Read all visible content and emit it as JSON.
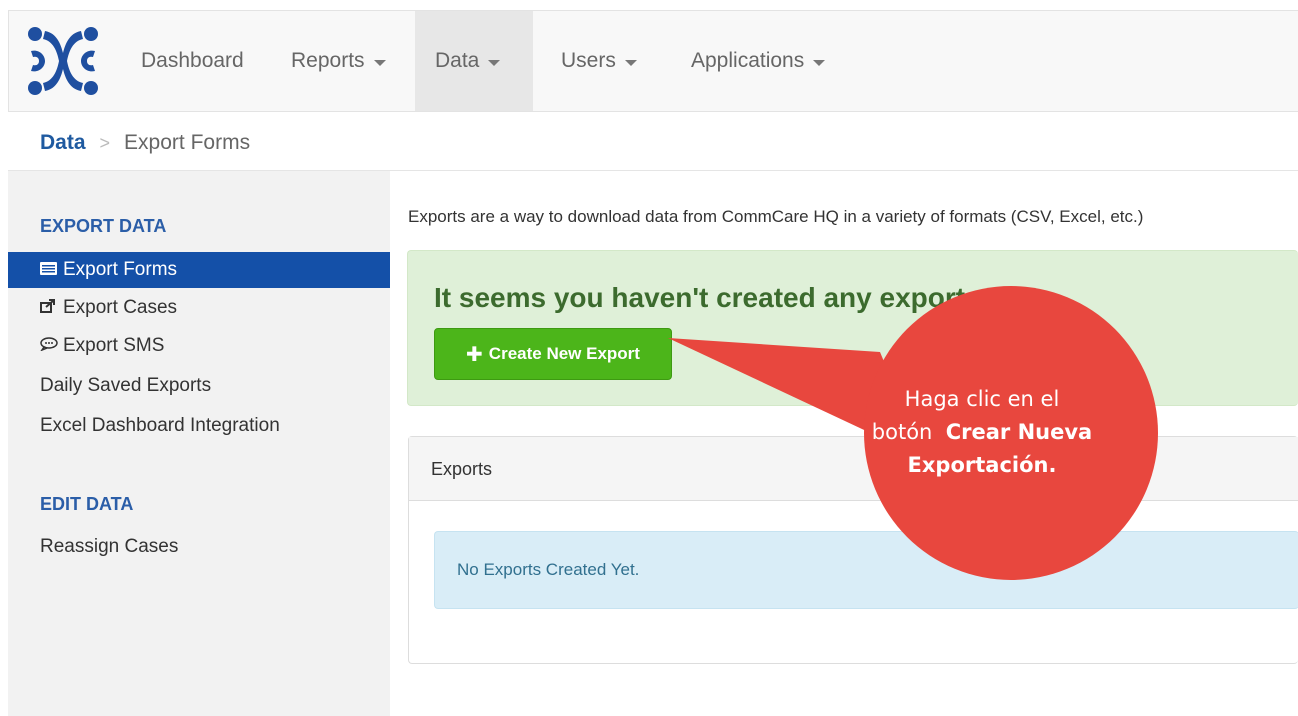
{
  "nav": {
    "items": [
      {
        "label": "Dashboard",
        "dropdown": false
      },
      {
        "label": "Reports",
        "dropdown": true
      },
      {
        "label": "Data",
        "dropdown": true,
        "active": true
      },
      {
        "label": "Users",
        "dropdown": true
      },
      {
        "label": "Applications",
        "dropdown": true
      }
    ]
  },
  "breadcrumb": {
    "parent": "Data",
    "separator": ">",
    "current": "Export Forms"
  },
  "sidebar": {
    "export_heading": "EXPORT DATA",
    "export_items": [
      {
        "label": "Export Forms",
        "icon": "list-icon",
        "active": true
      },
      {
        "label": "Export Cases",
        "icon": "share-icon"
      },
      {
        "label": "Export SMS",
        "icon": "chat-icon"
      },
      {
        "label": "Daily Saved Exports"
      },
      {
        "label": "Excel Dashboard Integration"
      }
    ],
    "edit_heading": "EDIT DATA",
    "edit_items": [
      {
        "label": "Reassign Cases"
      }
    ]
  },
  "main": {
    "intro": "Exports are a way to download data from CommCare HQ in a variety of formats (CSV, Excel, etc.)",
    "alert_title": "It seems you haven't created any exports yet!",
    "create_button": "Create New Export",
    "panel_title": "Exports",
    "empty_message": "No Exports Created Yet."
  },
  "callout": {
    "line1": "Haga clic en el",
    "line2_prefix": "botón",
    "line2_bold": "Crear Nueva",
    "line3_bold": "Exportación.",
    "color": "#e8473e"
  },
  "colors": {
    "active_sidebar": "#1450a8",
    "success_button": "#4cb51a",
    "success_alert": "#dff0d8",
    "info_alert": "#d9edf7",
    "link_blue": "#1f5aa0"
  }
}
